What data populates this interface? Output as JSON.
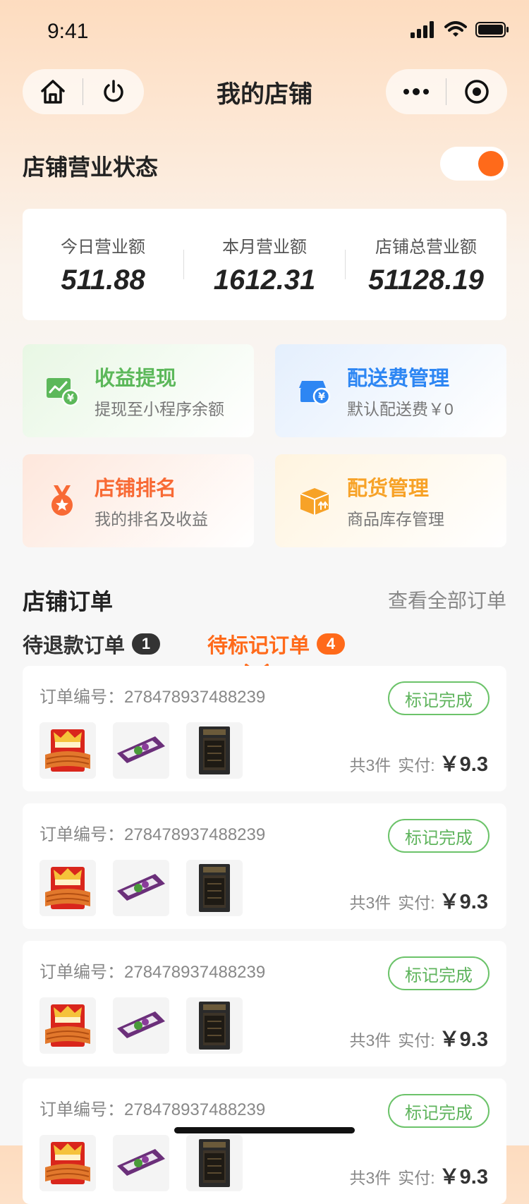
{
  "status_bar": {
    "time": "9:41"
  },
  "nav": {
    "title": "我的店铺"
  },
  "store_status": {
    "label": "店铺营业状态",
    "open": true
  },
  "revenue": [
    {
      "label": "今日营业额",
      "value": "511.88"
    },
    {
      "label": "本月营业额",
      "value": "1612.31"
    },
    {
      "label": "店铺总营业额",
      "value": "51128.19"
    }
  ],
  "tiles": [
    {
      "title": "收益提现",
      "subtitle": "提现至小程序余额",
      "color": "#5cb85a",
      "icon": "earnings-chart-icon"
    },
    {
      "title": "配送费管理",
      "subtitle": "默认配送费￥0",
      "color": "#2d86f3",
      "icon": "shop-yuan-icon"
    },
    {
      "title": "店铺排名",
      "subtitle": "我的排名及收益",
      "color": "#f86a35",
      "icon": "medal-icon"
    },
    {
      "title": "配货管理",
      "subtitle": "商品库存管理",
      "color": "#f7a227",
      "icon": "box-icon"
    }
  ],
  "orders_section": {
    "title": "店铺订单",
    "view_all": "查看全部订单",
    "tabs": [
      {
        "label": "待退款订单",
        "count": "1"
      },
      {
        "label": "待标记订单",
        "count": "4",
        "active": true
      }
    ]
  },
  "orders": [
    {
      "order_no": "订单编号：278478937488239",
      "button": "标记完成",
      "count_text": "共3件",
      "paid_label": "实付:",
      "amount": "￥9.3"
    },
    {
      "order_no": "订单编号：278478937488239",
      "button": "标记完成",
      "count_text": "共3件",
      "paid_label": "实付:",
      "amount": "￥9.3"
    },
    {
      "order_no": "订单编号：278478937488239",
      "button": "标记完成",
      "count_text": "共3件",
      "paid_label": "实付:",
      "amount": "￥9.3"
    },
    {
      "order_no": "订单编号：278478937488239",
      "button": "标记完成",
      "count_text": "共3件",
      "paid_label": "实付:",
      "amount": "￥9.3"
    }
  ],
  "colors": {
    "accent": "#ff6a1a",
    "green": "#5fb45d"
  }
}
